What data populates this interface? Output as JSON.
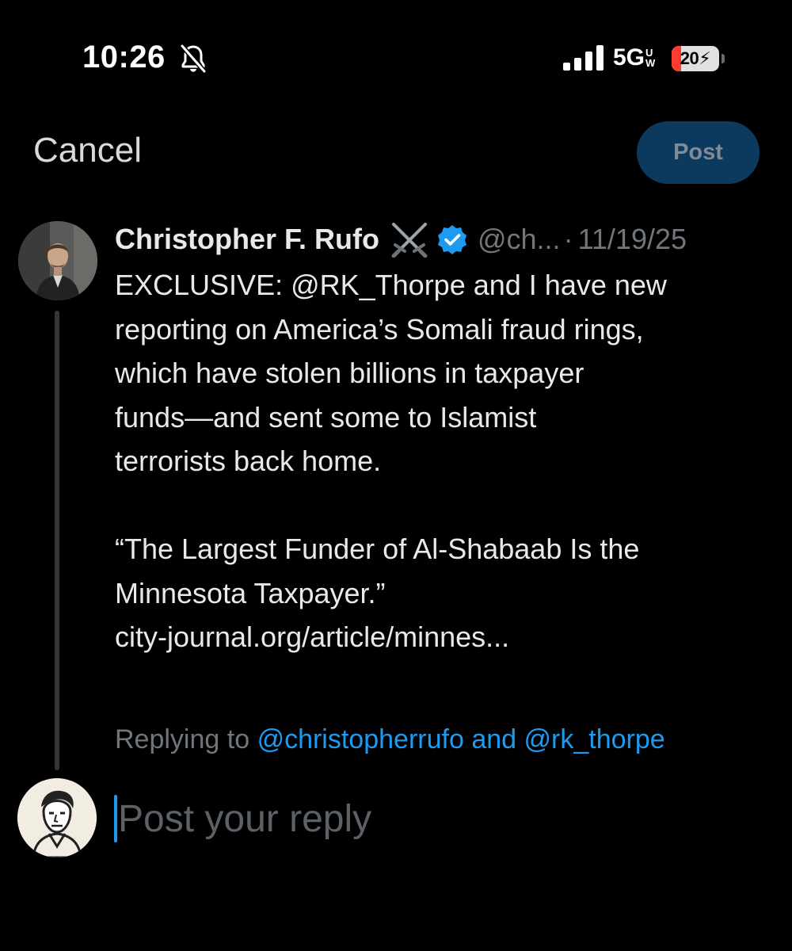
{
  "status_bar": {
    "time": "10:26",
    "network": "5G",
    "network_suffix_top": "U",
    "network_suffix_bottom": "W",
    "battery": "20",
    "battery_level": 0.2,
    "icons": [
      "bell-slash-icon",
      "cellular-signal-icon",
      "battery-charging-icon"
    ]
  },
  "header": {
    "cancel_label": "Cancel",
    "post_label": "Post"
  },
  "tweet": {
    "author_name": "Christopher F. Rufo",
    "name_emoji": "crossed-swords-icon",
    "handle": "@ch...",
    "separator": "·",
    "date": "11/19/25",
    "paragraph_1": "EXCLUSIVE: @RK_Thorpe and I have new\nreporting on America’s Somali fraud rings,\nwhich have stolen billions in taxpayer\nfunds—and sent some to Islamist\nterrorists back home.",
    "paragraph_2": "“The Largest Funder of Al-Shabaab Is the\nMinnesota Taxpayer.”\ncity-journal.org/article/minnes..."
  },
  "replying": {
    "prefix": "Replying to",
    "mention_1": "@christopherrufo",
    "conjunction": "and",
    "mention_2": "@rk_thorpe"
  },
  "reply": {
    "placeholder": "Post your reply",
    "value": ""
  },
  "colors": {
    "background": "#000000",
    "accent": "#1d9bf0",
    "post_button_bg": "#0c3a5e",
    "muted_text": "#71767b",
    "battery_low": "#ff3b30"
  }
}
